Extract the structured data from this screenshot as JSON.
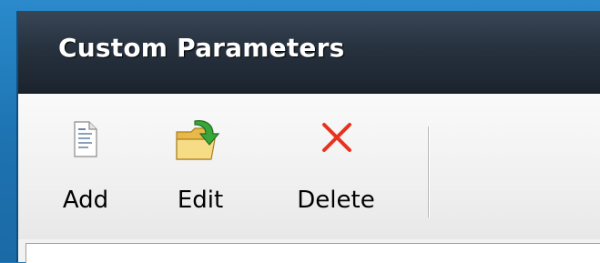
{
  "window": {
    "title": "Custom Parameters"
  },
  "toolbar": {
    "add_label": "Add",
    "edit_label": "Edit",
    "delete_label": "Delete"
  },
  "icons": {
    "add": "document-icon",
    "edit": "folder-arrow-icon",
    "delete": "red-x-icon"
  },
  "colors": {
    "titlebar": "#27323f",
    "title_text": "#ffffff",
    "delete_icon": "#e8321e",
    "edit_arrow": "#3aa63a",
    "folder": "#f5d77a",
    "desktop": "#1f78b8"
  }
}
